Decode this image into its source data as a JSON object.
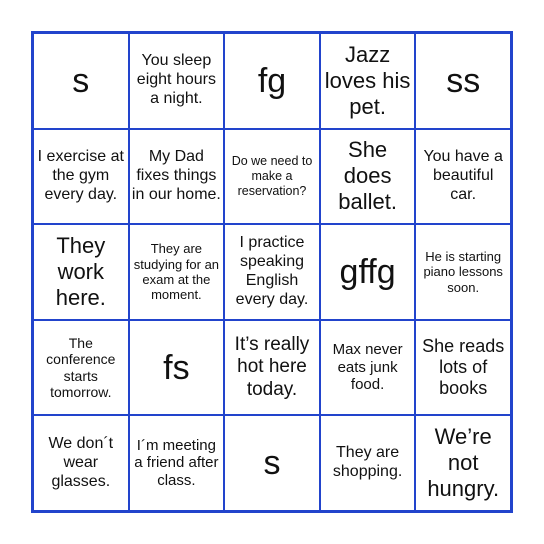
{
  "card": {
    "accent_color": "#2244cc",
    "cells": [
      [
        "s",
        "You sleep eight hours a night.",
        "fg",
        "Jazz loves his pet.",
        "ss"
      ],
      [
        "I exercise at the gym every day.",
        "My Dad fixes things in our home.",
        "Do we need to make a reservation?",
        "She does ballet.",
        "You have a beautiful car."
      ],
      [
        "They work here.",
        "They are studying for an exam at the moment.",
        "I practice speaking English every day.",
        "gffg",
        "He is starting piano lessons soon."
      ],
      [
        "The conference starts tomorrow.",
        "fs",
        "It’s really hot here today.",
        "Max never eats junk food.",
        "She reads lots of books"
      ],
      [
        "We don´t wear glasses.",
        "I´m meeting a friend after class.",
        "s",
        "They are shopping.",
        "We’re not hungry."
      ]
    ]
  }
}
